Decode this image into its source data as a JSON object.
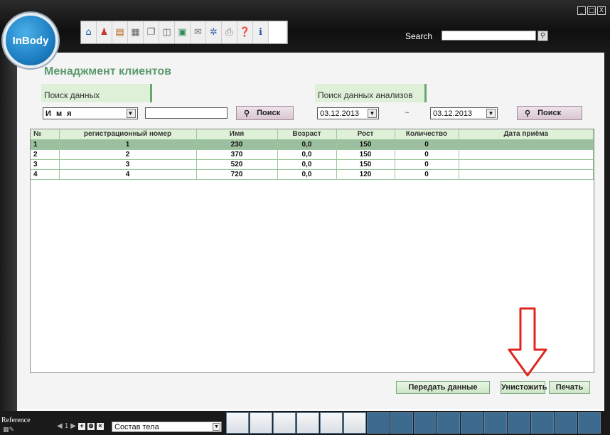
{
  "app": {
    "logo_text": "InBody",
    "window_controls": [
      "_",
      "□",
      "X"
    ],
    "search_label": "Search",
    "search_value": ""
  },
  "toolbar": {
    "icons": [
      "home-icon",
      "user-icon",
      "book-icon",
      "document-icon",
      "copy-icon",
      "layout-icon",
      "image-icon",
      "mail-icon",
      "gear-icon",
      "printer-icon",
      "help-icon",
      "info-icon"
    ]
  },
  "page": {
    "title": "Менаджмент клиентов",
    "search_data_label": "Поиск данных",
    "search_analyses_label": "Поиск данных анализов",
    "field_select": "И м я",
    "field_input": "",
    "search_button": "Поиск",
    "date_from": "03.12.2013",
    "date_sep": "~",
    "date_to": "03.12.2013",
    "search_button_2": "Поиск"
  },
  "table": {
    "columns": [
      "№",
      "регистрационный номер",
      "Имя",
      "Возраст",
      "Рост",
      "Количество",
      "Дата приёма"
    ],
    "rows": [
      [
        "1",
        "1",
        "230",
        "0,0",
        "150",
        "0",
        ""
      ],
      [
        "2",
        "2",
        "370",
        "0,0",
        "150",
        "0",
        ""
      ],
      [
        "3",
        "3",
        "520",
        "0,0",
        "150",
        "0",
        ""
      ],
      [
        "4",
        "4",
        "720",
        "0,0",
        "120",
        "0",
        ""
      ]
    ]
  },
  "actions": {
    "send_label": "Передать данные",
    "delete_label": "Унистожить",
    "print_label": "Печать"
  },
  "bottom": {
    "reference_label": "Reference",
    "page_num": "1",
    "mode_select": "Состав тела"
  }
}
